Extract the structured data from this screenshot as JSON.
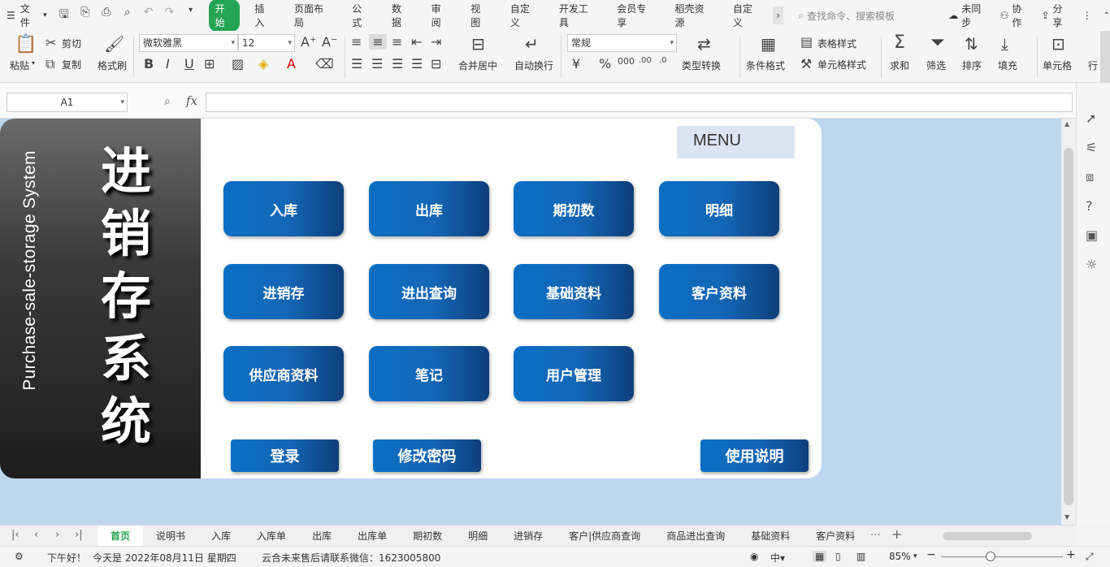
{
  "menubar": {
    "file_label": "文件",
    "tabs": [
      "开始",
      "插入",
      "页面布局",
      "公式",
      "数据",
      "审阅",
      "视图",
      "自定义",
      "开发工具",
      "会员专享",
      "稻壳资源",
      "自定义"
    ],
    "active_tab": "开始",
    "search_placeholder": "查找命令、搜索模板",
    "sync_label": "未同步",
    "collab_label": "协作",
    "share_label": "分享"
  },
  "ribbon": {
    "paste": "粘贴",
    "cut": "剪切",
    "copy": "复制",
    "format_painter": "格式刷",
    "font_name": "微软雅黑",
    "font_size": "12",
    "merge_center": "合并居中",
    "wrap_text": "自动换行",
    "number_format": "常规",
    "type_convert": "类型转换",
    "cond_format": "条件格式",
    "table_style": "表格样式",
    "cell_style": "单元格样式",
    "sum": "求和",
    "filter": "筛选",
    "sort": "排序",
    "fill": "填充",
    "cell": "单元格",
    "row_col": "行"
  },
  "formula_bar": {
    "cell_ref": "A1"
  },
  "sheet_content": {
    "eng_title": "Purchase-sale-storage System",
    "cn_title": "进销存系统",
    "menu_label": "MENU",
    "buttons": {
      "inbound": "入库",
      "outbound": "出库",
      "opening": "期初数",
      "detail": "明细",
      "pss": "进销存",
      "io_query": "进出查询",
      "basic_data": "基础资料",
      "customer_data": "客户资料",
      "supplier_data": "供应商资料",
      "notes": "笔记",
      "user_mgmt": "用户管理",
      "login": "登录",
      "change_pwd": "修改密码",
      "instructions": "使用说明"
    }
  },
  "sheet_tabs": [
    "首页",
    "说明书",
    "入库",
    "入库单",
    "出库",
    "出库单",
    "期初数",
    "明细",
    "进销存",
    "客户|供应商查询",
    "商品进出查询",
    "基础资料",
    "客户资料"
  ],
  "active_sheet": "首页",
  "status": {
    "greeting": "下午好！",
    "date": "今天是 2022年08月11日 星期四",
    "contact": "云合未来售后请联系微信：1623005800",
    "zoom": "85%"
  },
  "colors": {
    "accent": "#26a455",
    "sheet_bg": "#bdd7ee",
    "button_blue": "#0a6fc4"
  }
}
